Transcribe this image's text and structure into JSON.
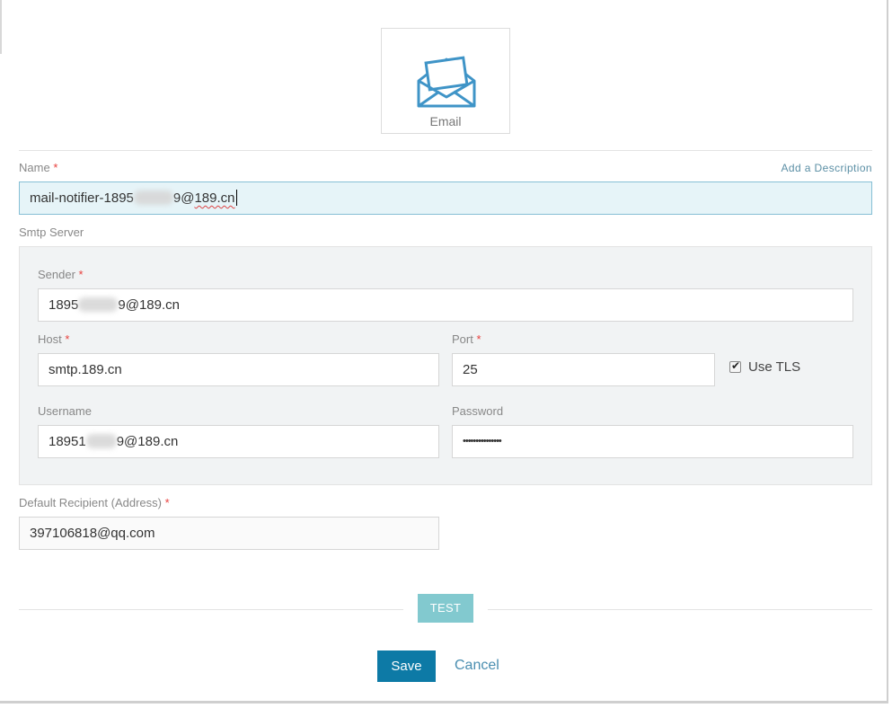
{
  "notifier_type": {
    "label": "Email",
    "icon": "email-envelope-icon"
  },
  "name_field": {
    "label": "Name",
    "required_marker": "*",
    "value_prefix": "mail-notifier-1895",
    "value_suffix_a": "9@",
    "value_suffix_b": "189.cn",
    "add_description": "Add a Description"
  },
  "smtp": {
    "section_label": "Smtp Server",
    "sender": {
      "label": "Sender",
      "required_marker": "*",
      "value_prefix": "1895",
      "value_suffix": "9@189.cn"
    },
    "host": {
      "label": "Host",
      "required_marker": "*",
      "value": "smtp.189.cn"
    },
    "port": {
      "label": "Port",
      "required_marker": "*",
      "value": "25"
    },
    "use_tls": {
      "label": "Use TLS",
      "checked": true
    },
    "username": {
      "label": "Username",
      "value_prefix": "18951",
      "value_suffix": "9@189.cn"
    },
    "password": {
      "label": "Password",
      "value": "•••••••••••••••"
    }
  },
  "recipient": {
    "label": "Default Recipient (Address)",
    "required_marker": "*",
    "value": "397106818@qq.com"
  },
  "actions": {
    "test": "TEST",
    "save": "Save",
    "cancel": "Cancel"
  },
  "colors": {
    "accent": "#0d7aa6",
    "test_button": "#82c9cf",
    "required": "#e8413e",
    "focus_bg": "#e6f4f8"
  }
}
